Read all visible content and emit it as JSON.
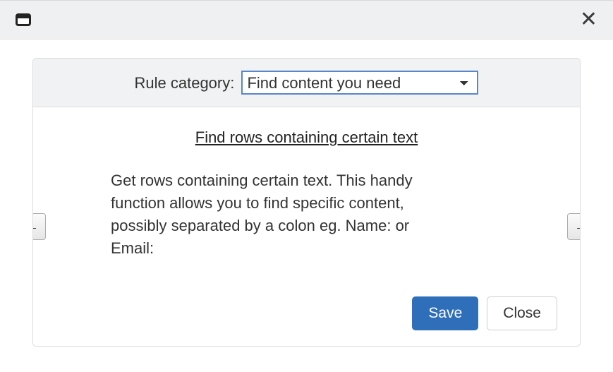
{
  "topbar": {
    "close_glyph": "✕"
  },
  "header": {
    "label": "Rule category:",
    "selected": "Find content you need"
  },
  "rule": {
    "title": "Find rows containing certain text",
    "description": "Get rows containing certain text. This handy function allows you to find specific content, possibly separated by a colon eg. Name: or Email:"
  },
  "nav": {
    "prev_glyph": "←",
    "next_glyph": "→"
  },
  "buttons": {
    "save": "Save",
    "close": "Close"
  }
}
